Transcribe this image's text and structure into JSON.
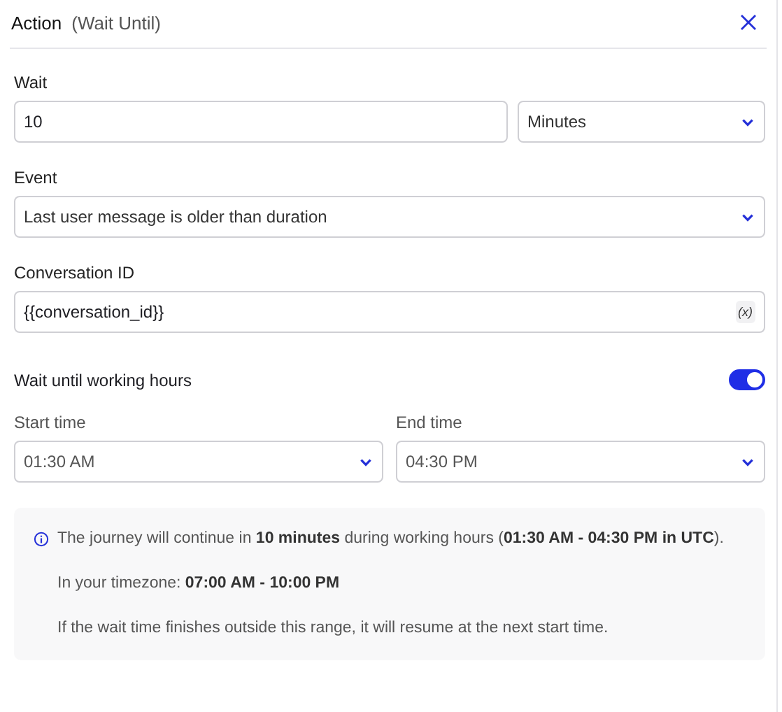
{
  "header": {
    "title": "Action",
    "subtitle": "(Wait Until)"
  },
  "wait": {
    "label": "Wait",
    "value": "10",
    "unit": "Minutes"
  },
  "event": {
    "label": "Event",
    "value": "Last user message is older than duration"
  },
  "conversation": {
    "label": "Conversation ID",
    "value": "{{conversation_id}}",
    "variable_button": "(x)"
  },
  "working_hours": {
    "label": "Wait until working hours",
    "on": true,
    "times": [
      {
        "label": "Start time",
        "value": "01:30 AM"
      },
      {
        "label": "End time",
        "value": "04:30 PM"
      }
    ]
  },
  "info": {
    "paragraphs": [
      "The journey will continue in **10 minutes** during working hours (**01:30 AM - 04:30 PM in UTC**).",
      "In your timezone: **07:00 AM - 10:00 PM**",
      "If the wait time finishes outside this range, it will resume at the next start time."
    ]
  }
}
